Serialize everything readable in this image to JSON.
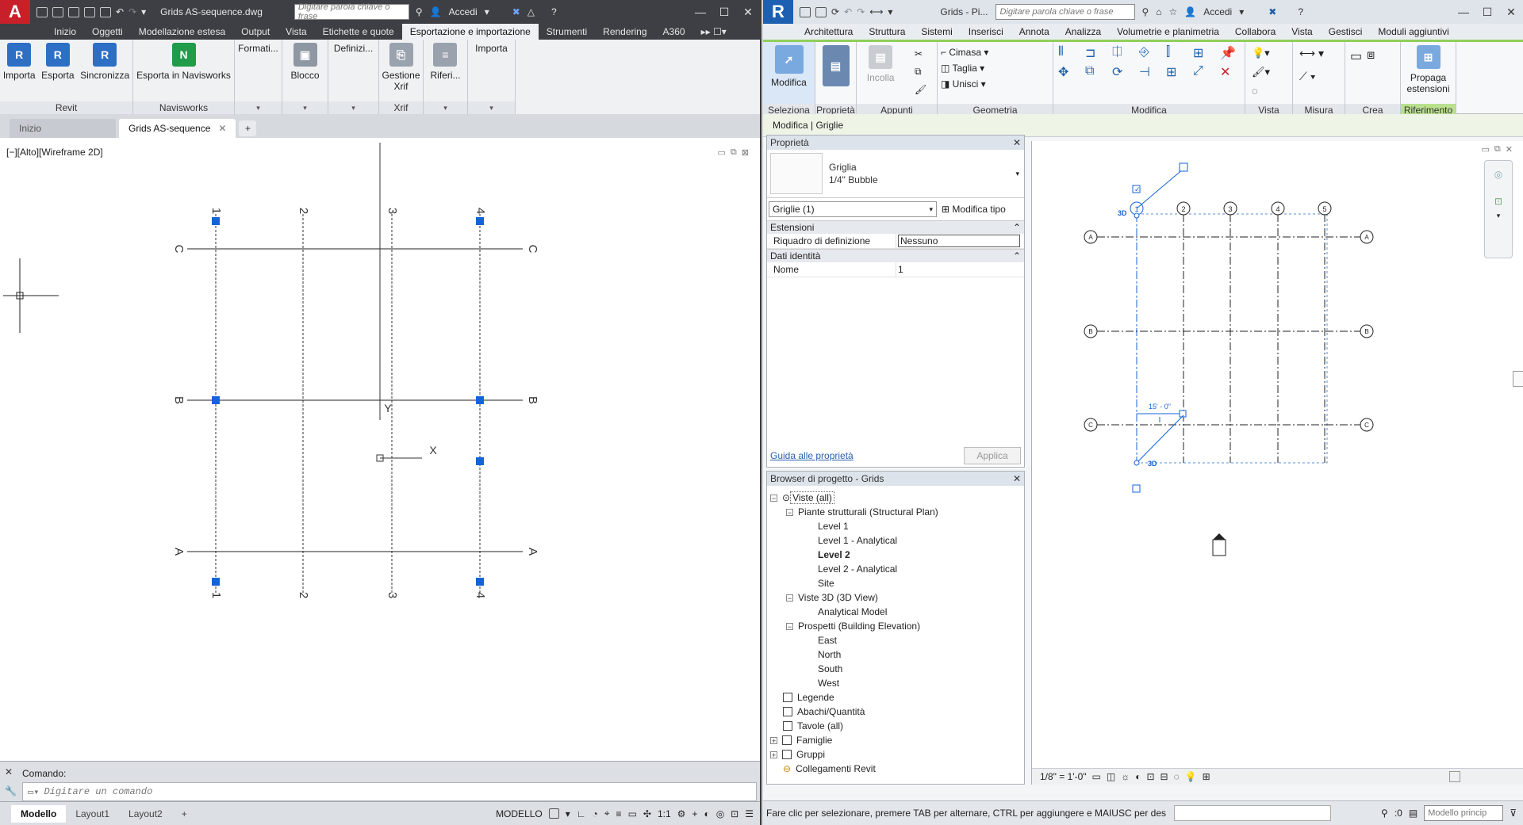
{
  "acad": {
    "logo": "A",
    "title": "Grids AS-sequence.dwg",
    "search_placeholder": "Digitare parola chiave o frase",
    "signin": "Accedi",
    "tabs": [
      "Inizio",
      "Oggetti",
      "Modellazione estesa",
      "Output",
      "Vista",
      "Etichette e quote",
      "Esportazione e importazione",
      "Strumenti",
      "Rendering",
      "A360"
    ],
    "active_tab": "Esportazione e importazione",
    "ribbon": {
      "revit_panel": "Revit",
      "importa": "Importa",
      "esporta": "Esporta",
      "sincronizza": "Sincronizza",
      "navisworks_panel": "Navisworks",
      "esporta_navisworks": "Esporta in Navisworks",
      "formati": "Formati...",
      "blocco": "Blocco",
      "definizioni": "Definizi...",
      "gestione_xrif": "Gestione Xrif",
      "xrif_panel": "Xrif",
      "riferimenti": "Riferi...",
      "importa2": "Importa"
    },
    "doc_tabs": [
      "Inizio",
      "Grids AS-sequence"
    ],
    "viewport_label": "[−][Alto][Wireframe 2D]",
    "grid_labels": {
      "v": [
        "1",
        "2",
        "3",
        "4"
      ],
      "h": [
        "C",
        "B",
        "A"
      ]
    },
    "ucs": {
      "x": "X",
      "y": "Y"
    },
    "command_label": "Comando:",
    "command_placeholder": "Digitare un comando",
    "layout_tabs": [
      "Modello",
      "Layout1",
      "Layout2"
    ],
    "mode": "MODELLO",
    "scale": "1:1"
  },
  "revit": {
    "logo": "R",
    "title": "Grids - Pi...",
    "search_placeholder": "Digitare parola chiave o frase",
    "signin": "Accedi",
    "tabs": [
      "Architettura",
      "Struttura",
      "Sistemi",
      "Inserisci",
      "Annota",
      "Analizza",
      "Volumetrie e planimetria",
      "Collabora",
      "Vista",
      "Gestisci",
      "Moduli aggiuntivi"
    ],
    "ribbon": {
      "modifica": "Modifica",
      "seleziona": "Seleziona",
      "proprieta": "Proprietà",
      "incolla": "Incolla",
      "appunti": "Appunti",
      "cimasa": "Cimasa",
      "taglia": "Taglia",
      "unisci": "Unisci",
      "geometria": "Geometria",
      "modifica_panel": "Modifica",
      "vista": "Vista",
      "misura": "Misura",
      "crea": "Crea",
      "propaga": "Propaga estensioni",
      "riferimento": "Riferimento"
    },
    "context": "Modifica | Griglie",
    "properties": {
      "title": "Proprietà",
      "type_name": "Griglia",
      "type_sub": "1/4\" Bubble",
      "instance": "Griglie (1)",
      "edit_type": "Modifica tipo",
      "group1": "Estensioni",
      "row1_key": "Riquadro di definizione",
      "row1_val": "Nessuno",
      "group2": "Dati identità",
      "row2_key": "Nome",
      "row2_val": "1",
      "help": "Guida alle proprietà",
      "apply": "Applica"
    },
    "browser": {
      "title": "Browser di progetto - Grids",
      "nodes": [
        "Viste (all)",
        "Piante strutturali (Structural Plan)",
        "Level 1",
        "Level 1 - Analytical",
        "Level 2",
        "Level 2 - Analytical",
        "Site",
        "Viste 3D (3D View)",
        "Analytical Model",
        "Prospetti (Building Elevation)",
        "East",
        "North",
        "South",
        "West",
        "Legende",
        "Abachi/Quantità",
        "Tavole (all)",
        "Famiglie",
        "Gruppi",
        "Collegamenti Revit"
      ]
    },
    "grid_labels": {
      "v": [
        "1",
        "2",
        "3",
        "4",
        "5"
      ],
      "h": [
        "A",
        "B",
        "C"
      ]
    },
    "tag_3d": "3D",
    "dim": "15' - 0\"",
    "view_scale": "1/8\" = 1'-0\"",
    "status": "Fare clic per selezionare, premere TAB per alternare, CTRL per aggiungere e MAIUSC per des",
    "status_count": ":0",
    "model": "Modello princip"
  },
  "colors": {
    "acad_red": "#c8202a",
    "revit_blue": "#1d5fb0",
    "select_blue": "#1463d8"
  }
}
